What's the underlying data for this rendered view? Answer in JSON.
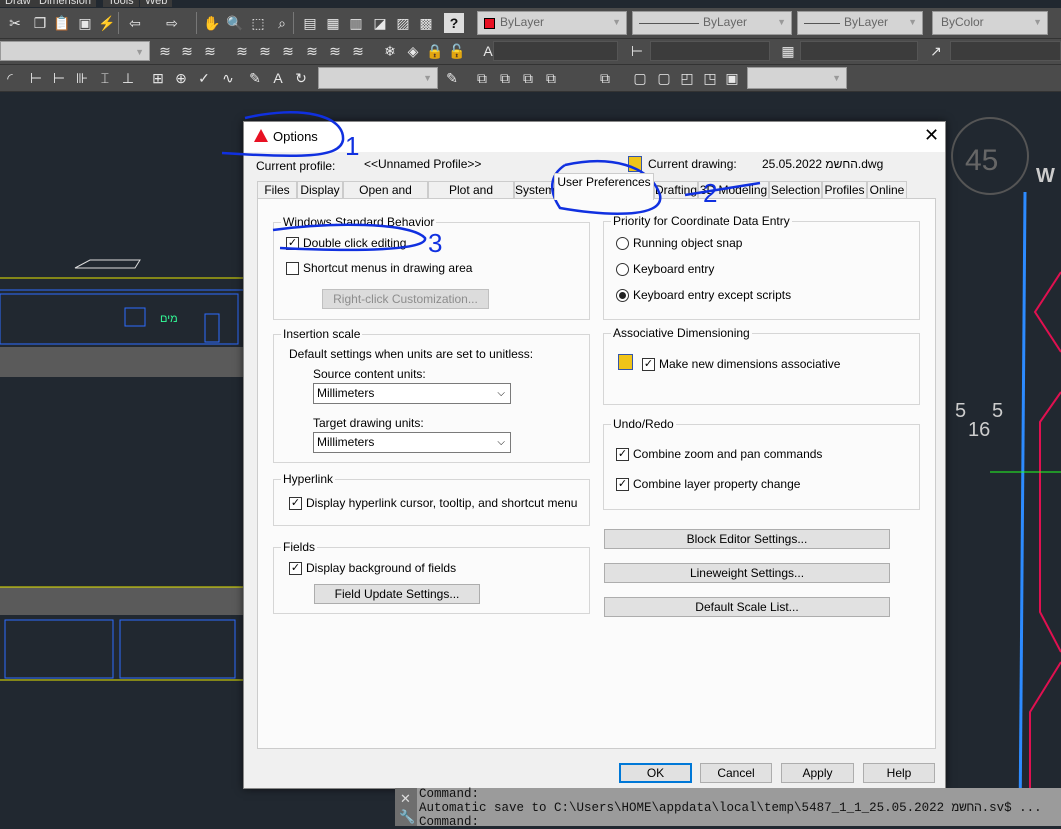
{
  "menu": [
    "Draw",
    "Dimension",
    "Tools",
    "Web"
  ],
  "toolbar": {
    "row1_icons": [
      "cut-icon",
      "copy-icon",
      "paste-icon",
      "match-properties-icon",
      "block-editor-icon",
      "undo-icon",
      "redo-icon",
      "pan-icon",
      "zoom-realtime-icon",
      "zoom-window-icon",
      "zoom-previous-icon",
      "properties-icon",
      "design-center-icon",
      "tool-palettes-icon",
      "sheet-set-icon",
      "markup-icon",
      "calculator-icon",
      "help-icon"
    ],
    "color_combo": "ByLayer",
    "linetype_combo": "ByLayer",
    "lineweight_combo": "ByLayer",
    "plotstyle_combo": "ByColor",
    "accent_color": "#e81123"
  },
  "dialog": {
    "title": "Options",
    "annotations": [
      "1",
      "2",
      "3"
    ],
    "current_profile_label": "Current profile:",
    "current_profile_value": "<<Unnamed Profile>>",
    "current_drawing_label": "Current drawing:",
    "current_drawing_value": "25.05.2022 החשמ.dwg",
    "tabs": [
      "Files",
      "Display",
      "Open and Save",
      "Plot and Publish",
      "System",
      "User Preferences",
      "Drafting",
      "3D Modeling",
      "Selection",
      "Profiles",
      "Online"
    ],
    "active_tab": "User Preferences",
    "windows_behavior": {
      "title": "Windows Standard Behavior",
      "double_click": "Double click editing",
      "double_click_checked": true,
      "shortcut_menus": "Shortcut menus in drawing area",
      "shortcut_menus_checked": false,
      "right_click_button": "Right-click Customization..."
    },
    "insertion_scale": {
      "title": "Insertion scale",
      "description": "Default settings when units are set to unitless:",
      "source_label": "Source content units:",
      "source_value": "Millimeters",
      "target_label": "Target drawing units:",
      "target_value": "Millimeters"
    },
    "hyperlink": {
      "title": "Hyperlink",
      "option": "Display hyperlink cursor, tooltip, and shortcut menu",
      "checked": true
    },
    "fields": {
      "title": "Fields",
      "option": "Display background of fields",
      "checked": true,
      "button": "Field Update Settings..."
    },
    "priority": {
      "title": "Priority for Coordinate Data Entry",
      "options": [
        "Running object snap",
        "Keyboard entry",
        "Keyboard entry except scripts"
      ],
      "selected": 2
    },
    "assoc_dim": {
      "title": "Associative Dimensioning",
      "option": "Make new dimensions associative",
      "checked": true
    },
    "undo_redo": {
      "title": "Undo/Redo",
      "zoom_pan": "Combine zoom and pan commands",
      "layer_change": "Combine layer property change"
    },
    "buttons": {
      "block_editor": "Block Editor Settings...",
      "lineweight": "Lineweight Settings...",
      "scale_list": "Default Scale List..."
    },
    "footer": {
      "ok": "OK",
      "cancel": "Cancel",
      "apply": "Apply",
      "help": "Help"
    }
  },
  "command_line": [
    "Command:",
    "Automatic save to C:\\Users\\HOME\\appdata\\local\\temp\\5487_1_1_25.05.2022 החשמ.sv$ ...",
    "Command:"
  ],
  "drawing_text": {
    "circle_label": "45",
    "w": "W",
    "n1": "5",
    "n2": "5",
    "n3": "16",
    "sign": "מים"
  }
}
